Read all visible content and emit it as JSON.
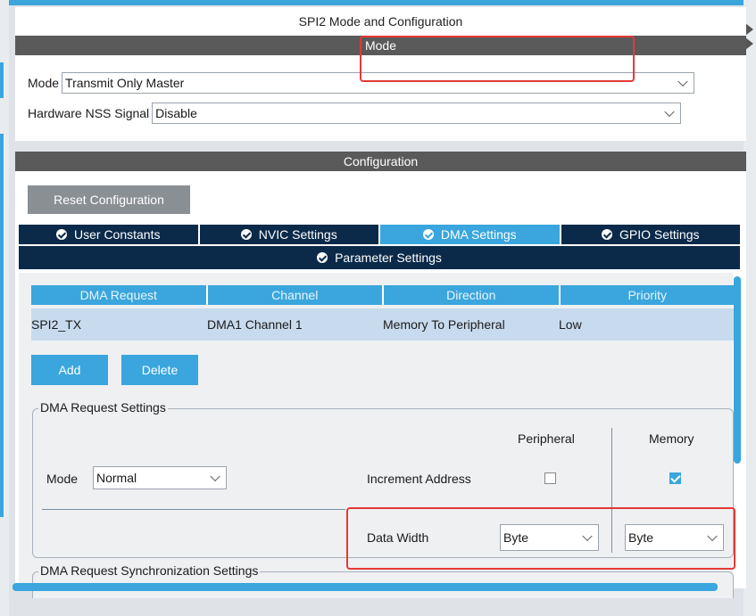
{
  "mode_panel": {
    "title": "SPI2 Mode and Configuration",
    "section": "Mode",
    "mode_label": "Mode",
    "mode_value": "Transmit Only Master",
    "nss_label": "Hardware NSS Signal",
    "nss_value": "Disable"
  },
  "config_panel": {
    "section": "Configuration",
    "reset_label": "Reset Configuration",
    "tabs": [
      {
        "label": "User Constants",
        "active": false
      },
      {
        "label": "NVIC Settings",
        "active": false
      },
      {
        "label": "DMA Settings",
        "active": true
      },
      {
        "label": "GPIO Settings",
        "active": false
      }
    ],
    "param_tab": "Parameter Settings"
  },
  "dma_table": {
    "headers": [
      "DMA Request",
      "Channel",
      "Direction",
      "Priority"
    ],
    "rows": [
      {
        "request": "SPI2_TX",
        "channel": "DMA1 Channel 1",
        "direction": "Memory To Peripheral",
        "priority": "Low"
      }
    ],
    "add_label": "Add",
    "delete_label": "Delete"
  },
  "request_settings": {
    "legend": "DMA Request Settings",
    "peripheral_header": "Peripheral",
    "memory_header": "Memory",
    "mode_label": "Mode",
    "mode_value": "Normal",
    "increment_label": "Increment Address",
    "increment_peripheral": false,
    "increment_memory": true,
    "width_label": "Data Width",
    "width_peripheral": "Byte",
    "width_memory": "Byte"
  },
  "sync_settings": {
    "legend": "DMA Request Synchronization Settings"
  },
  "colors": {
    "accent": "#3aa6dd",
    "navy": "#0b2a4a",
    "highlight": "#e53935"
  }
}
